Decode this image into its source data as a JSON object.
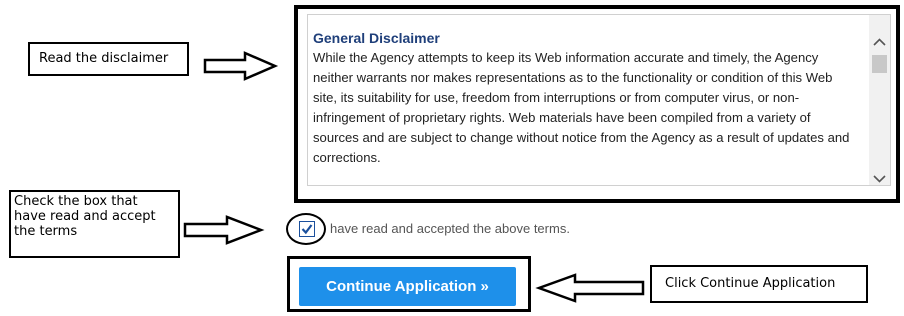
{
  "callouts": {
    "read": "Read the disclaimer",
    "check": "Check the box that\nhave read and accept\nthe terms",
    "continue": "Click Continue Application"
  },
  "disclaimer": {
    "title": "General Disclaimer",
    "body": "While the Agency attempts to keep its Web information accurate and timely, the Agency neither warrants nor makes representations as to the functionality or condition of this Web site, its suitability for use, freedom from interruptions or from computer virus, or non-infringement of proprietary rights. Web materials have been compiled from a variety of sources and are subject to change without notice from the Agency as a result of updates and corrections."
  },
  "accept": {
    "checked": true,
    "label": "have read and accepted the above terms."
  },
  "continue_button": {
    "label": "Continue Application »",
    "color": "#1e90ea"
  }
}
